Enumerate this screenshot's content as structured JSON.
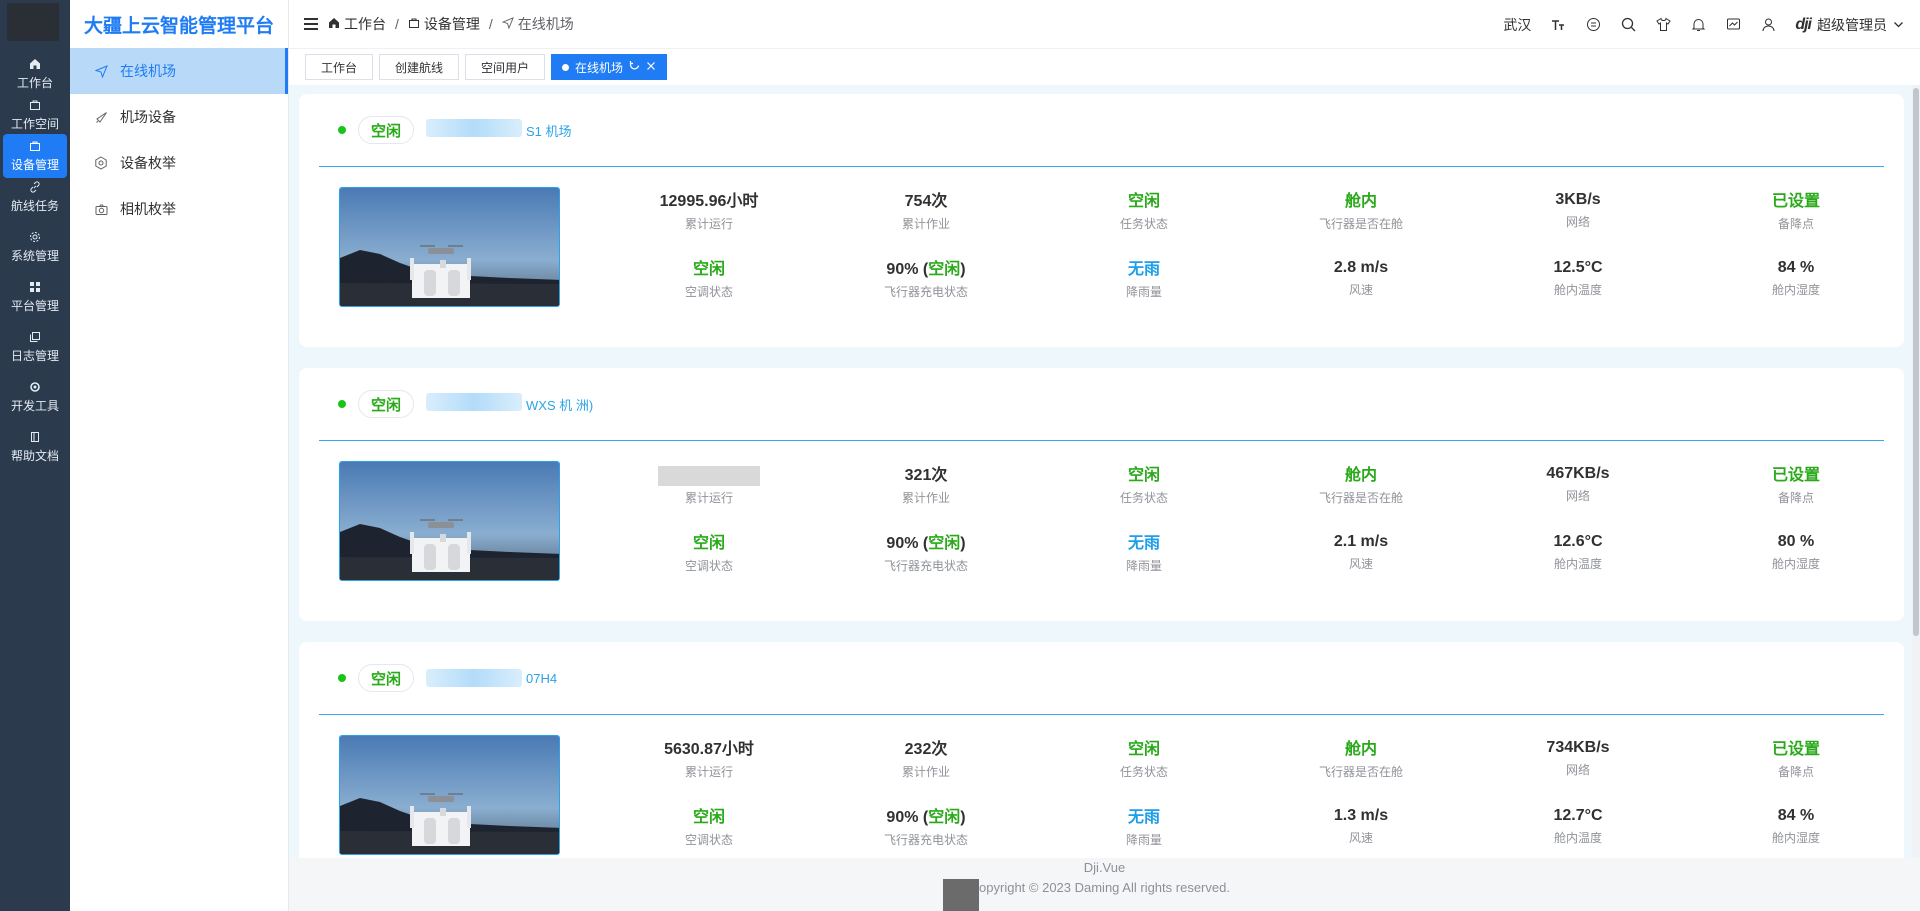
{
  "platform": {
    "title": "大疆上云智能管理平台"
  },
  "rail": {
    "items": [
      {
        "label": "工作台",
        "icon": "home-icon"
      },
      {
        "label": "工作空间",
        "icon": "briefcase-icon"
      },
      {
        "label": "设备管理",
        "icon": "briefcase-icon"
      },
      {
        "label": "航线任务",
        "icon": "link-icon"
      },
      {
        "label": "系统管理",
        "icon": "gear-icon"
      },
      {
        "label": "平台管理",
        "icon": "grid-icon"
      },
      {
        "label": "日志管理",
        "icon": "copy-icon"
      },
      {
        "label": "开发工具",
        "icon": "settings-icon"
      },
      {
        "label": "帮助文档",
        "icon": "book-icon"
      }
    ]
  },
  "submenu": {
    "items": [
      {
        "label": "在线机场",
        "icon": "navigation-icon"
      },
      {
        "label": "机场设备",
        "icon": "rocket-icon"
      },
      {
        "label": "设备枚举",
        "icon": "hexagon-icon"
      },
      {
        "label": "相机枚举",
        "icon": "camera-icon"
      }
    ]
  },
  "breadcrumb": {
    "items": [
      "工作台",
      "设备管理",
      "在线机场"
    ]
  },
  "header": {
    "city": "武汉",
    "user": "超级管理员",
    "brand": "dji"
  },
  "tags": {
    "items": [
      "工作台",
      "创建航线",
      "空间用户"
    ],
    "active": "在线机场"
  },
  "labels": {
    "total_runtime": "累计运行",
    "total_jobs": "累计作业",
    "task_status": "任务状态",
    "in_cabin": "飞行器是否在舱",
    "network": "网络",
    "alternate": "备降点",
    "ac_status": "空调状态",
    "charge_status": "飞行器充电状态",
    "rainfall": "降雨量",
    "wind_speed": "风速",
    "cabin_temp": "舱内温度",
    "cabin_humidity": "舱内湿度"
  },
  "docks": [
    {
      "status": "空闲",
      "name": "S1 机场",
      "runtime": "12995.96小时",
      "jobs": "754次",
      "task": "空闲",
      "cabin": "舱内",
      "network": "3KB/s",
      "alternate": "已设置",
      "ac": "空闲",
      "charge_pct": "90% (",
      "charge_state": "空闲",
      "charge_close": ")",
      "rain": "无雨",
      "wind": "2.8 m/s",
      "temp": "12.5°C",
      "humidity": "84 %"
    },
    {
      "status": "空闲",
      "name": "WXS 机 洲)",
      "runtime": "",
      "jobs": "321次",
      "task": "空闲",
      "cabin": "舱内",
      "network": "467KB/s",
      "alternate": "已设置",
      "ac": "空闲",
      "charge_pct": "90% (",
      "charge_state": "空闲",
      "charge_close": ")",
      "rain": "无雨",
      "wind": "2.1 m/s",
      "temp": "12.6°C",
      "humidity": "80 %"
    },
    {
      "status": "空闲",
      "name": "07H4",
      "runtime": "5630.87小时",
      "jobs": "232次",
      "task": "空闲",
      "cabin": "舱内",
      "network": "734KB/s",
      "alternate": "已设置",
      "ac": "空闲",
      "charge_pct": "90% (",
      "charge_state": "空闲",
      "charge_close": ")",
      "rain": "无雨",
      "wind": "1.3 m/s",
      "temp": "12.7°C",
      "humidity": "84 %"
    }
  ],
  "footer": {
    "line1": "Dji.Vue",
    "line2": "opyright © 2023 Daming All rights reserved."
  },
  "colors": {
    "accent": "#1f7cf4",
    "status_green": "#2aaa1a",
    "rain_blue": "#1d9ee9",
    "rail_bg": "#2b3a4d"
  }
}
